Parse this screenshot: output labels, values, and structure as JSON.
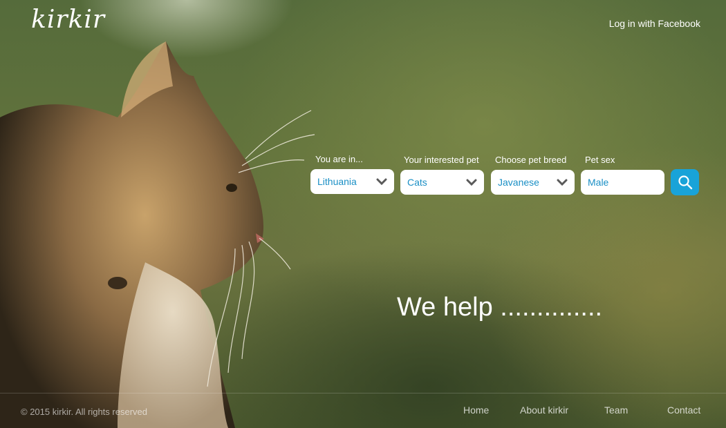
{
  "header": {
    "logo": "kirkir",
    "login": "Log in with Facebook"
  },
  "search": {
    "fields": [
      {
        "label": "You are in...",
        "value": "Lithuania",
        "icon": "chevron-down-icon"
      },
      {
        "label": "Your interested pet",
        "value": "Cats",
        "icon": "chevron-down-icon"
      },
      {
        "label": "Choose pet breed",
        "value": "Javanese",
        "icon": "chevron-down-icon"
      },
      {
        "label": "Pet sex",
        "value": "Male"
      }
    ],
    "button_icon": "search-icon"
  },
  "headline": "We help ..............",
  "footer": {
    "copyright": "© 2015 kirkir. All rights reserved",
    "nav": [
      "Home",
      "About kirkir",
      "Team",
      "Contact"
    ]
  },
  "colors": {
    "accent": "#19a3d8",
    "select_text": "#1a8fc5",
    "text": "#ffffff"
  }
}
